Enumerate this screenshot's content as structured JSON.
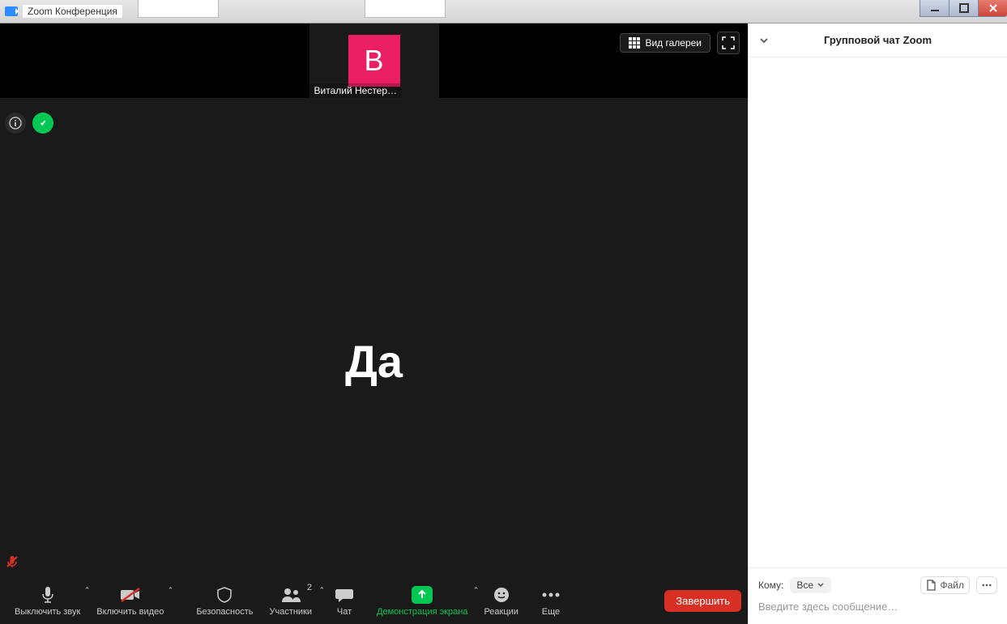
{
  "window": {
    "title": "Zoom Конференция"
  },
  "thumbnail": {
    "avatar_letter": "В",
    "name": "Виталий Нестер…"
  },
  "view": {
    "gallery_label": "Вид галереи"
  },
  "center": {
    "text": "Да"
  },
  "toolbar": {
    "mute": "Выключить звук",
    "video": "Включить видео",
    "security": "Безопасность",
    "participants": "Участники",
    "participants_count": "2",
    "chat": "Чат",
    "share": "Демонстрация экрана",
    "reactions": "Реакции",
    "more": "Еще",
    "end": "Завершить"
  },
  "chat": {
    "title": "Групповой чат Zoom",
    "to_label": "Кому:",
    "to_value": "Все",
    "file_label": "Файл",
    "placeholder": "Введите здесь сообщение…"
  }
}
